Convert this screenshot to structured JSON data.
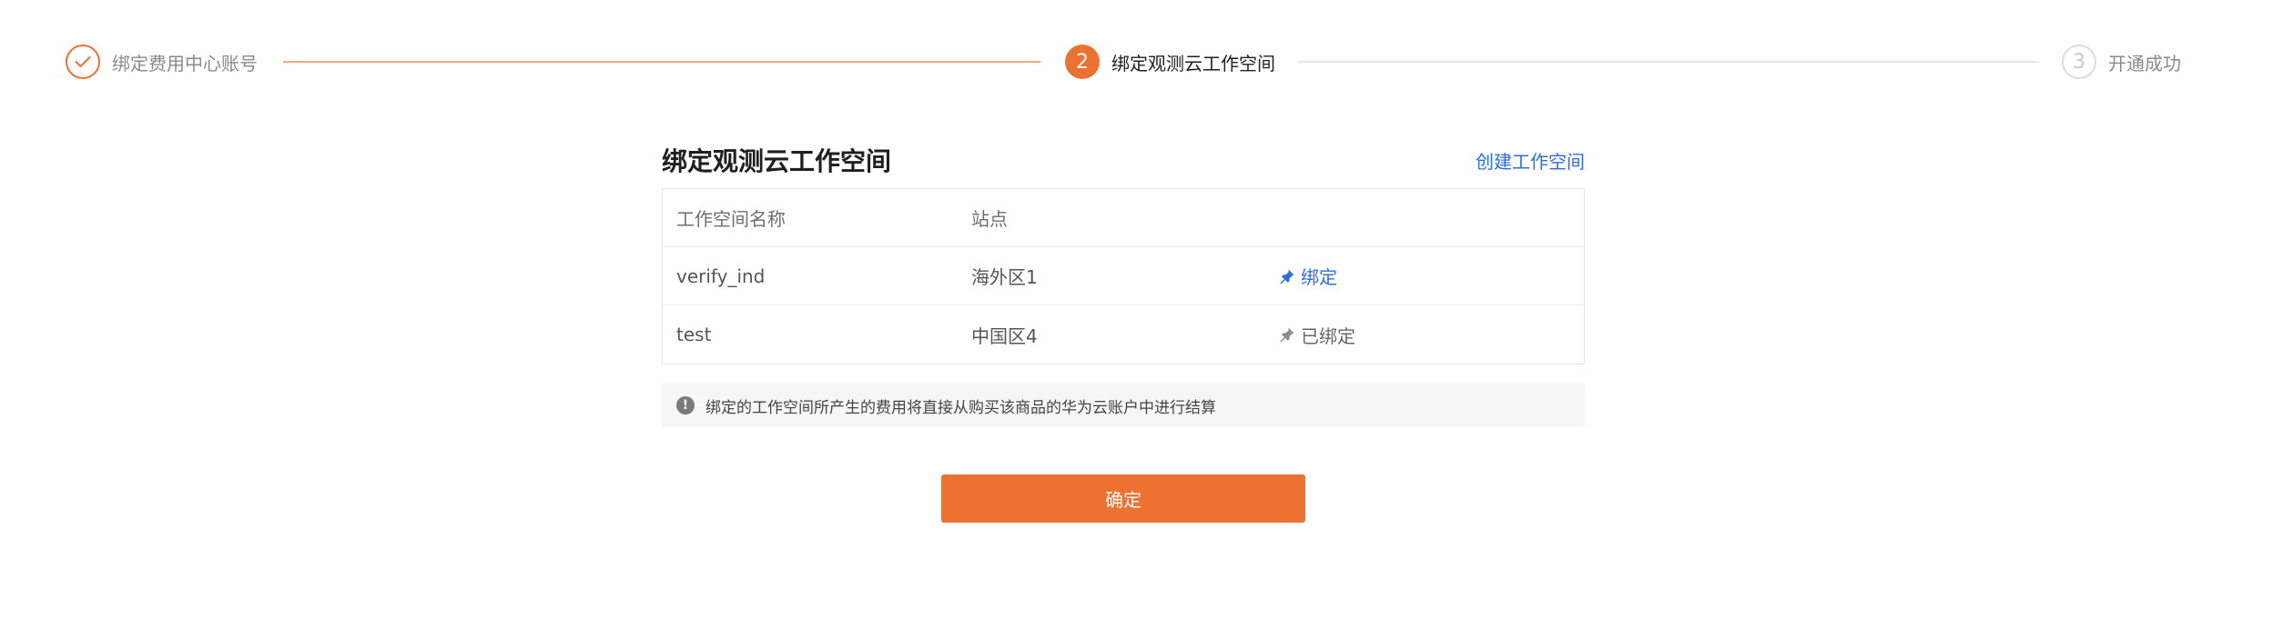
{
  "stepper": {
    "steps": [
      {
        "number": "",
        "label": "绑定费用中心账号",
        "state": "done",
        "icon": "check-icon"
      },
      {
        "number": "2",
        "label": "绑定观测云工作空间",
        "state": "active"
      },
      {
        "number": "3",
        "label": "开通成功",
        "state": "pending"
      }
    ]
  },
  "section": {
    "title": "绑定观测云工作空间",
    "create_link": "创建工作空间"
  },
  "table": {
    "columns": [
      "工作空间名称",
      "站点",
      ""
    ],
    "rows": [
      {
        "name": "verify_ind",
        "site": "海外区1",
        "action": "绑定",
        "action_state": "bindable",
        "icon": "pin-icon"
      },
      {
        "name": "test",
        "site": "中国区4",
        "action": "已绑定",
        "action_state": "bound",
        "icon": "pin-icon"
      }
    ]
  },
  "notice": {
    "icon": "exclamation-icon",
    "text": "绑定的工作空间所产生的费用将直接从购买该商品的华为云账户中进行结算"
  },
  "confirm_button": "确定",
  "colors": {
    "accent": "#ed7130",
    "link": "#2b6de5",
    "connector_done": "#f5a97a",
    "connector_pending": "#e8e8e8"
  }
}
